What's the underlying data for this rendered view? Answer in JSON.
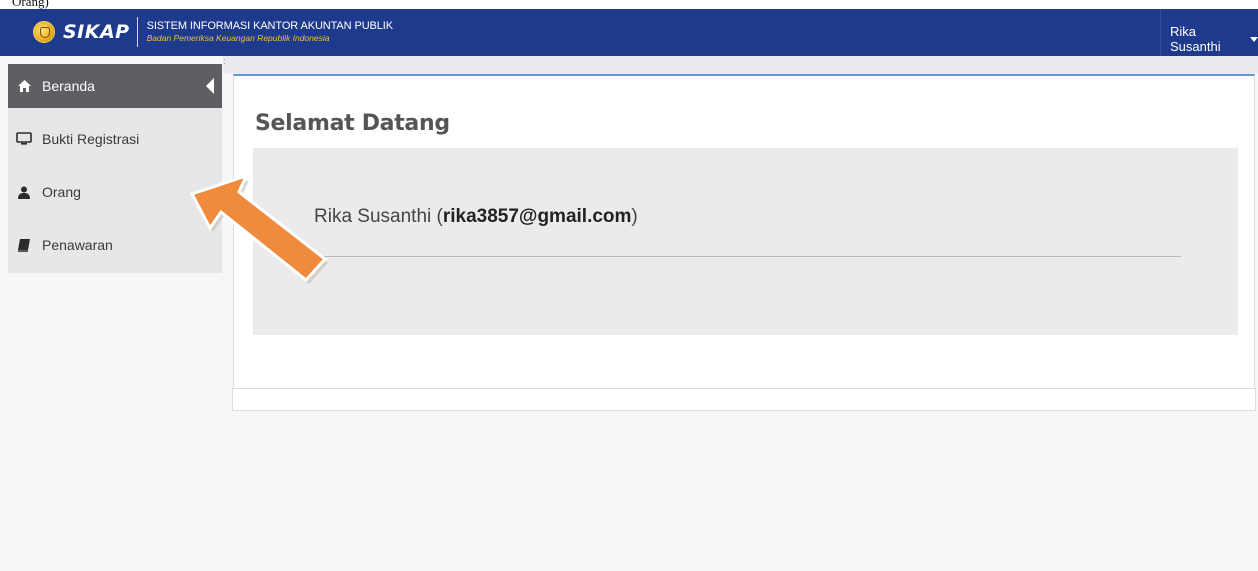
{
  "top_strip": {
    "text": "Orang)"
  },
  "header": {
    "logo_text": "SIKAP",
    "title": "SISTEM INFORMASI KANTOR AKUNTAN PUBLIK",
    "subtitle": "Badan Pemeriksa Keuangan Republik Indonesia",
    "user_name": "Rika Susanthi",
    "colors": {
      "navbar": "#1e3a8c",
      "subtitle": "#f2c230"
    }
  },
  "sidebar": {
    "items": [
      {
        "label": "Beranda",
        "icon": "home-icon",
        "active": true
      },
      {
        "label": "Bukti Registrasi",
        "icon": "monitor-icon",
        "active": false
      },
      {
        "label": "Orang",
        "icon": "user-icon",
        "active": false
      },
      {
        "label": "Penawaran",
        "icon": "book-icon",
        "active": false
      }
    ]
  },
  "main": {
    "page_title": "Selamat Datang",
    "welcome": {
      "name": "Rika Susanthi",
      "open_paren": " (",
      "email": "rika3857@gmail.com",
      "close_paren": ")"
    }
  },
  "annotation": {
    "arrow_color": "#f08a3c",
    "points_to": "Orang"
  }
}
